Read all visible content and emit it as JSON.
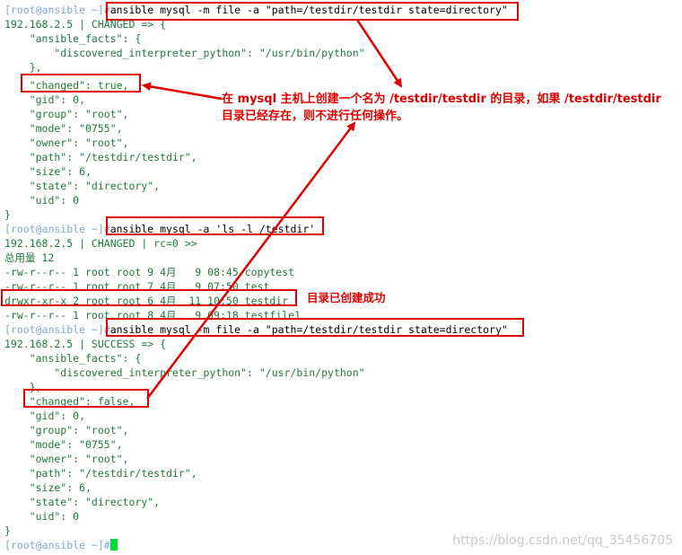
{
  "terminal": {
    "prompt": "[root@ansible ~]#",
    "commands": {
      "file_cmd": "ansible mysql -m file -a \"path=/testdir/testdir state=directory\"",
      "ls_cmd": "ansible mysql -a 'ls -l /testdir'"
    },
    "run1": {
      "header": "192.168.2.5 | CHANGED => {",
      "facts_open": "    \"ansible_facts\": {",
      "interpreter": "        \"discovered_interpreter_python\": \"/usr/bin/python\"",
      "facts_close": "    },",
      "changed": "    \"changed\": true,",
      "gid": "    \"gid\": 0,",
      "group": "    \"group\": \"root\",",
      "mode": "    \"mode\": \"0755\",",
      "owner": "    \"owner\": \"root\",",
      "path": "    \"path\": \"/testdir/testdir\",",
      "size": "    \"size\": 6,",
      "state": "    \"state\": \"directory\",",
      "uid": "    \"uid\": 0",
      "close": "}"
    },
    "ls": {
      "header": "192.168.2.5 | CHANGED | rc=0 >>",
      "total": "总用量 12",
      "rows": [
        "-rw-r--r-- 1 root root 9 4月   9 08:45 copytest",
        "-rw-r--r-- 1 root root 7 4月   9 07:50 test",
        "drwxr-xr-x 2 root root 6 4月  11 10:50 testdir",
        "-rw-r--r-- 1 root root 8 4月   9 09:18 testfile1"
      ]
    },
    "run2": {
      "header": "192.168.2.5 | SUCCESS => {",
      "facts_open": "    \"ansible_facts\": {",
      "interpreter": "        \"discovered_interpreter_python\": \"/usr/bin/python\"",
      "facts_close": "    },",
      "changed": "    \"changed\": false,",
      "gid": "    \"gid\": 0,",
      "group": "    \"group\": \"root\",",
      "mode": "    \"mode\": \"0755\",",
      "owner": "    \"owner\": \"root\",",
      "path": "    \"path\": \"/testdir/testdir\",",
      "size": "    \"size\": 6,",
      "state": "    \"state\": \"directory\",",
      "uid": "    \"uid\": 0",
      "close": "}"
    }
  },
  "annotations": {
    "note_line1": "在 mysql 主机上创建一个名为 /testdir/testdir 的目录，如果 /testdir/testdir",
    "note_line2": "目录已经存在，则不进行任何操作。",
    "success_note": "目录已创建成功"
  },
  "watermark": "https://blog.csdn.net/qq_35456705",
  "colors": {
    "annotation_red": "#e00000",
    "output_green": "#1f7a3f",
    "prompt_blue": "#7fa8d6",
    "cursor_green": "#00dd33"
  }
}
